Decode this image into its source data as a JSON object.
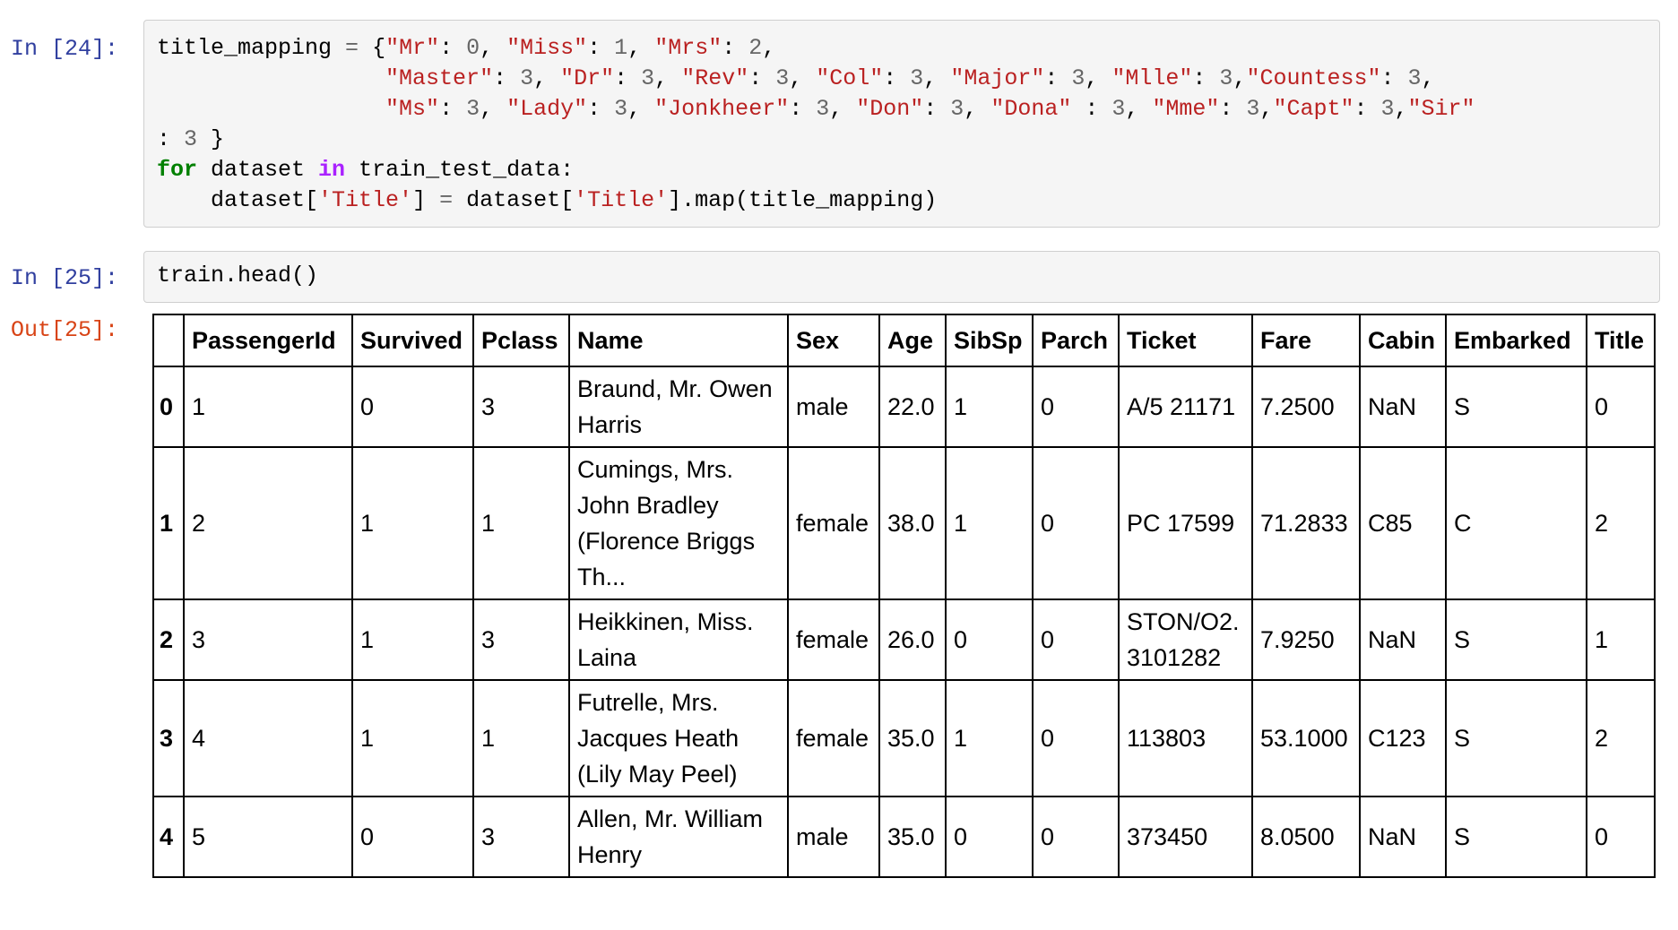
{
  "cells": [
    {
      "prompt": "In [24]:",
      "code_lines": [
        [
          {
            "t": "n",
            "v": "title_mapping "
          },
          {
            "t": "op",
            "v": "="
          },
          {
            "t": "n",
            "v": " {"
          },
          {
            "t": "s",
            "v": "\"Mr\""
          },
          {
            "t": "n",
            "v": ": "
          },
          {
            "t": "op",
            "v": "0"
          },
          {
            "t": "n",
            "v": ", "
          },
          {
            "t": "s",
            "v": "\"Miss\""
          },
          {
            "t": "n",
            "v": ": "
          },
          {
            "t": "op",
            "v": "1"
          },
          {
            "t": "n",
            "v": ", "
          },
          {
            "t": "s",
            "v": "\"Mrs\""
          },
          {
            "t": "n",
            "v": ": "
          },
          {
            "t": "op",
            "v": "2"
          },
          {
            "t": "n",
            "v": ","
          }
        ],
        [
          {
            "t": "n",
            "v": "                 "
          },
          {
            "t": "s",
            "v": "\"Master\""
          },
          {
            "t": "n",
            "v": ": "
          },
          {
            "t": "op",
            "v": "3"
          },
          {
            "t": "n",
            "v": ", "
          },
          {
            "t": "s",
            "v": "\"Dr\""
          },
          {
            "t": "n",
            "v": ": "
          },
          {
            "t": "op",
            "v": "3"
          },
          {
            "t": "n",
            "v": ", "
          },
          {
            "t": "s",
            "v": "\"Rev\""
          },
          {
            "t": "n",
            "v": ": "
          },
          {
            "t": "op",
            "v": "3"
          },
          {
            "t": "n",
            "v": ", "
          },
          {
            "t": "s",
            "v": "\"Col\""
          },
          {
            "t": "n",
            "v": ": "
          },
          {
            "t": "op",
            "v": "3"
          },
          {
            "t": "n",
            "v": ", "
          },
          {
            "t": "s",
            "v": "\"Major\""
          },
          {
            "t": "n",
            "v": ": "
          },
          {
            "t": "op",
            "v": "3"
          },
          {
            "t": "n",
            "v": ", "
          },
          {
            "t": "s",
            "v": "\"Mlle\""
          },
          {
            "t": "n",
            "v": ": "
          },
          {
            "t": "op",
            "v": "3"
          },
          {
            "t": "n",
            "v": ","
          },
          {
            "t": "s",
            "v": "\"Countess\""
          },
          {
            "t": "n",
            "v": ": "
          },
          {
            "t": "op",
            "v": "3"
          },
          {
            "t": "n",
            "v": ","
          }
        ],
        [
          {
            "t": "n",
            "v": "                 "
          },
          {
            "t": "s",
            "v": "\"Ms\""
          },
          {
            "t": "n",
            "v": ": "
          },
          {
            "t": "op",
            "v": "3"
          },
          {
            "t": "n",
            "v": ", "
          },
          {
            "t": "s",
            "v": "\"Lady\""
          },
          {
            "t": "n",
            "v": ": "
          },
          {
            "t": "op",
            "v": "3"
          },
          {
            "t": "n",
            "v": ", "
          },
          {
            "t": "s",
            "v": "\"Jonkheer\""
          },
          {
            "t": "n",
            "v": ": "
          },
          {
            "t": "op",
            "v": "3"
          },
          {
            "t": "n",
            "v": ", "
          },
          {
            "t": "s",
            "v": "\"Don\""
          },
          {
            "t": "n",
            "v": ": "
          },
          {
            "t": "op",
            "v": "3"
          },
          {
            "t": "n",
            "v": ", "
          },
          {
            "t": "s",
            "v": "\"Dona\""
          },
          {
            "t": "n",
            "v": " : "
          },
          {
            "t": "op",
            "v": "3"
          },
          {
            "t": "n",
            "v": ", "
          },
          {
            "t": "s",
            "v": "\"Mme\""
          },
          {
            "t": "n",
            "v": ": "
          },
          {
            "t": "op",
            "v": "3"
          },
          {
            "t": "n",
            "v": ","
          },
          {
            "t": "s",
            "v": "\"Capt\""
          },
          {
            "t": "n",
            "v": ": "
          },
          {
            "t": "op",
            "v": "3"
          },
          {
            "t": "n",
            "v": ","
          },
          {
            "t": "s",
            "v": "\"Sir\""
          }
        ],
        [
          {
            "t": "n",
            "v": ": "
          },
          {
            "t": "op",
            "v": "3"
          },
          {
            "t": "n",
            "v": " }"
          }
        ],
        [
          {
            "t": "kw",
            "v": "for"
          },
          {
            "t": "n",
            "v": " dataset "
          },
          {
            "t": "kwin",
            "v": "in"
          },
          {
            "t": "n",
            "v": " train_test_data:"
          }
        ],
        [
          {
            "t": "n",
            "v": "    dataset["
          },
          {
            "t": "s",
            "v": "'Title'"
          },
          {
            "t": "n",
            "v": "] "
          },
          {
            "t": "op",
            "v": "="
          },
          {
            "t": "n",
            "v": " dataset["
          },
          {
            "t": "s",
            "v": "'Title'"
          },
          {
            "t": "n",
            "v": "].map(title_mapping)"
          }
        ]
      ]
    },
    {
      "prompt": "In [25]:",
      "code_lines": [
        [
          {
            "t": "n",
            "v": "train.head()"
          }
        ]
      ]
    }
  ],
  "output": {
    "prompt": "Out[25]:",
    "columns": [
      "",
      "PassengerId",
      "Survived",
      "Pclass",
      "Name",
      "Sex",
      "Age",
      "SibSp",
      "Parch",
      "Ticket",
      "Fare",
      "Cabin",
      "Embarked",
      "Title"
    ],
    "rows": [
      [
        "0",
        "1",
        "0",
        "3",
        "Braund, Mr. Owen Harris",
        "male",
        "22.0",
        "1",
        "0",
        "A/5 21171",
        "7.2500",
        "NaN",
        "S",
        "0"
      ],
      [
        "1",
        "2",
        "1",
        "1",
        "Cumings, Mrs. John Bradley (Florence Briggs Th...",
        "female",
        "38.0",
        "1",
        "0",
        "PC 17599",
        "71.2833",
        "C85",
        "C",
        "2"
      ],
      [
        "2",
        "3",
        "1",
        "3",
        "Heikkinen, Miss. Laina",
        "female",
        "26.0",
        "0",
        "0",
        "STON/O2. 3101282",
        "7.9250",
        "NaN",
        "S",
        "1"
      ],
      [
        "3",
        "4",
        "1",
        "1",
        "Futrelle, Mrs. Jacques Heath (Lily May Peel)",
        "female",
        "35.0",
        "1",
        "0",
        "113803",
        "53.1000",
        "C123",
        "S",
        "2"
      ],
      [
        "4",
        "5",
        "0",
        "3",
        "Allen, Mr. William Henry",
        "male",
        "35.0",
        "0",
        "0",
        "373450",
        "8.0500",
        "NaN",
        "S",
        "0"
      ]
    ]
  }
}
